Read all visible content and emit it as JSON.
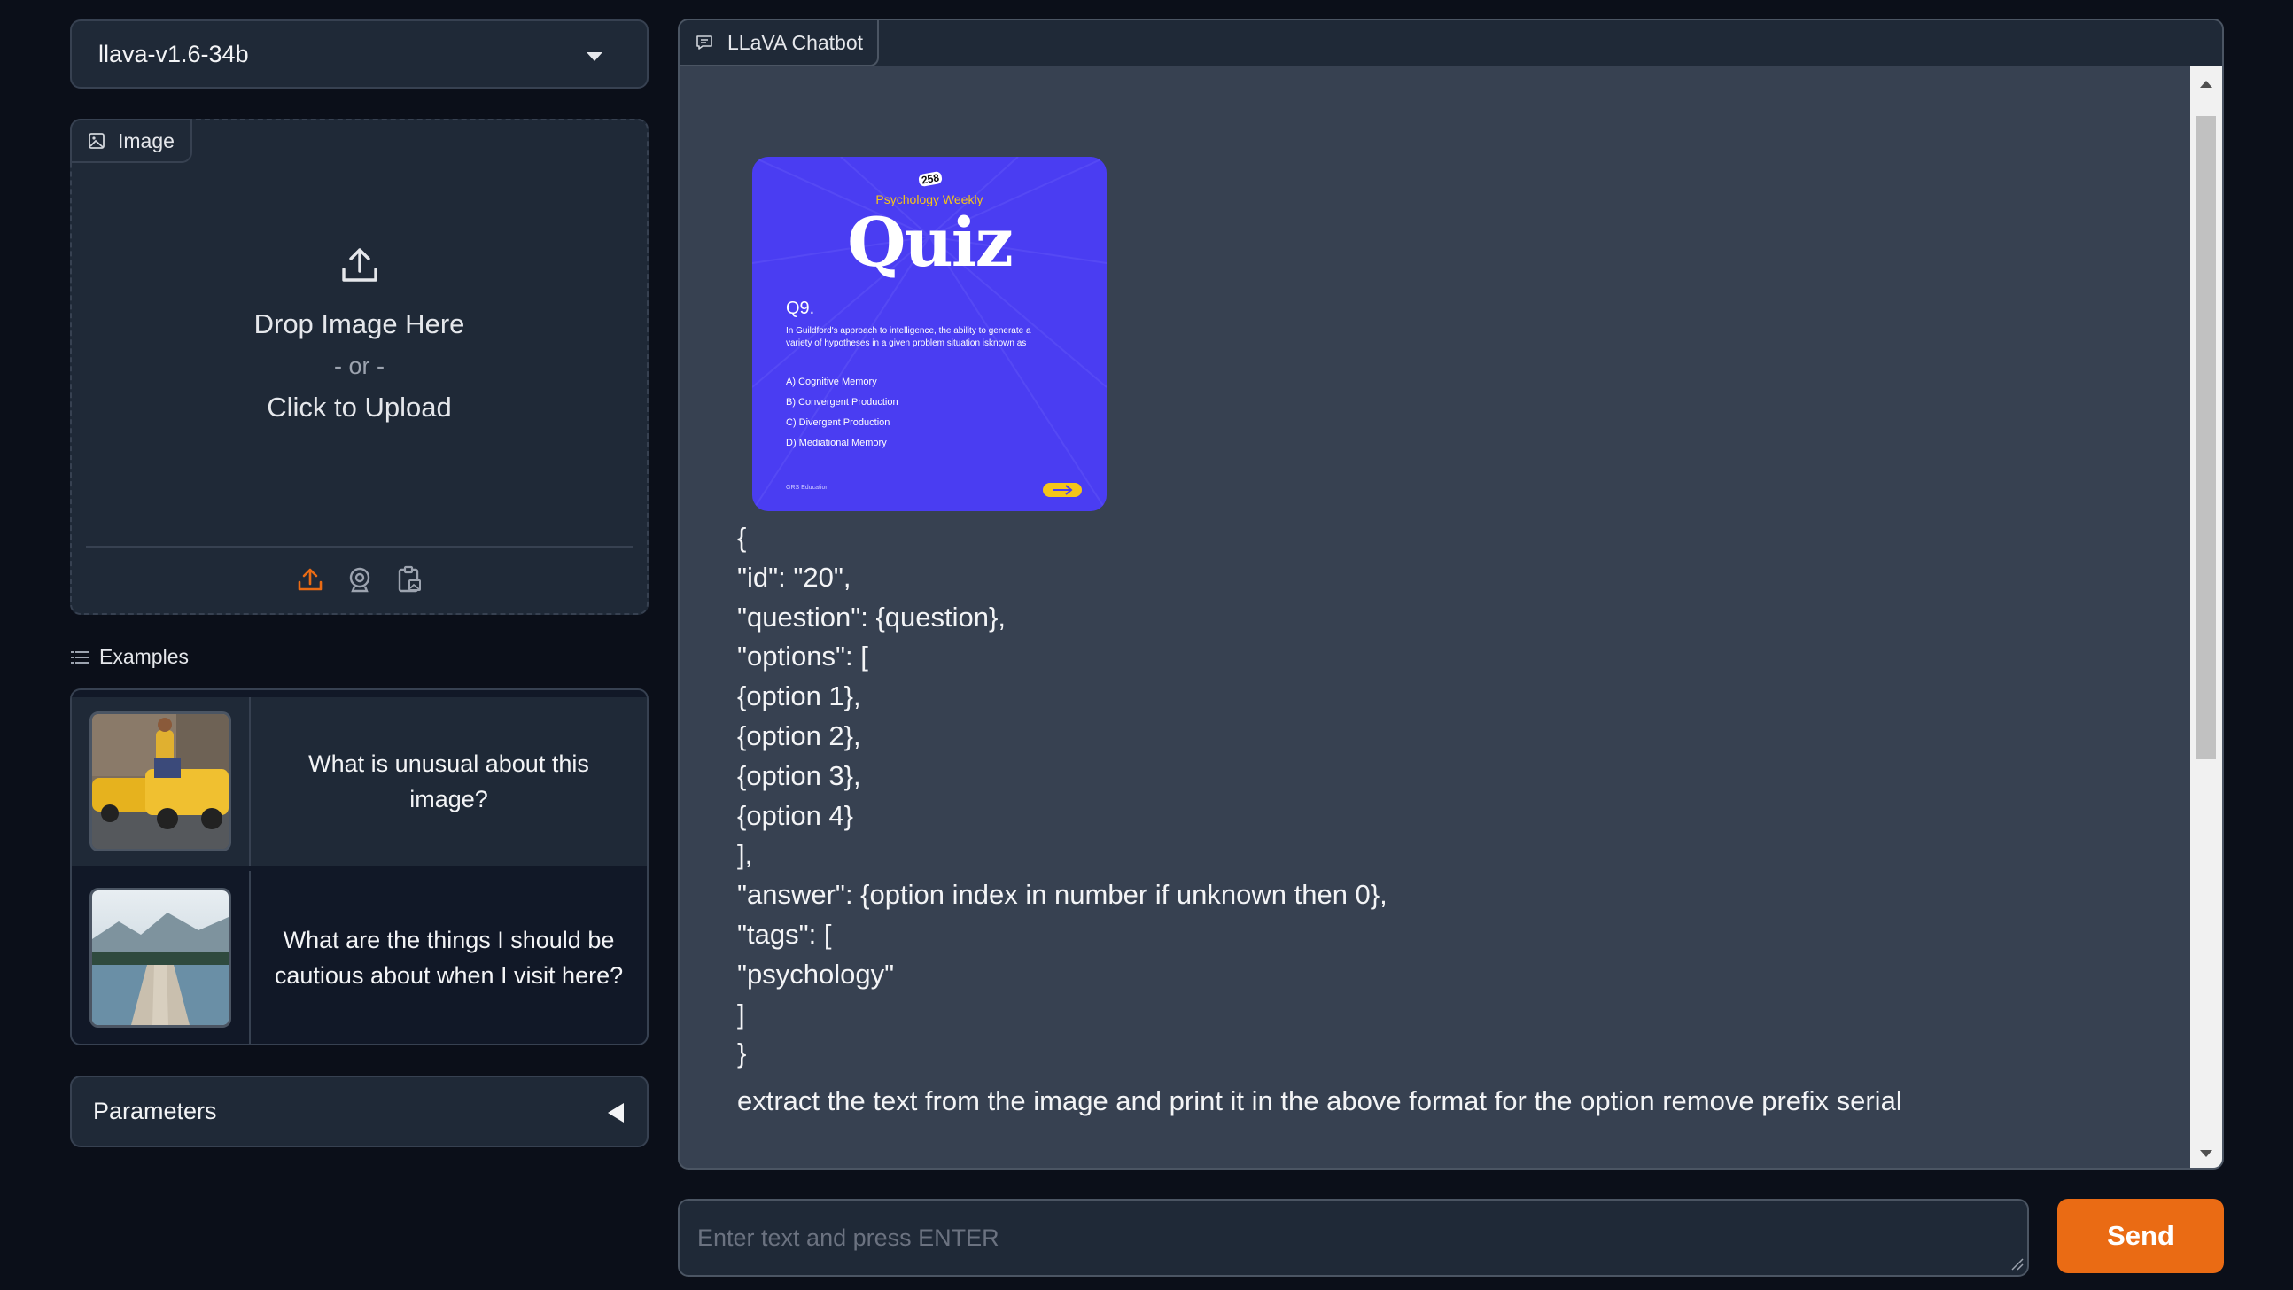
{
  "model_select": {
    "value": "llava-v1.6-34b"
  },
  "image_panel": {
    "tab_label": "Image",
    "drop_text": "Drop Image Here",
    "or_text": "- or -",
    "click_text": "Click to Upload",
    "source_icons": [
      "upload-icon",
      "webcam-icon",
      "clipboard-icon"
    ]
  },
  "examples": {
    "label": "Examples",
    "items": [
      {
        "text": "What is unusual about this image?"
      },
      {
        "text": "What are the things I should be cautious about when I visit here?"
      }
    ]
  },
  "parameters": {
    "label": "Parameters"
  },
  "chatbot": {
    "tab_label": "LLaVA Chatbot",
    "quiz_image": {
      "badge": "258",
      "subtitle": "Psychology Weekly",
      "title": "Quiz",
      "question_no": "Q9.",
      "question_text": "In Guildford's approach to intelligence, the ability to generate a variety of hypotheses in a given problem situation isknown as",
      "options": [
        "A) Cognitive Memory",
        "B) Convergent Production",
        "C) Divergent Production",
        "D) Mediational Memory"
      ],
      "footer": "GRS Education"
    },
    "json_lines": [
      "{",
      "\"id\": \"20\",",
      "\"question\": {question},",
      "\"options\": [",
      "{option 1},",
      "{option 2},",
      "{option 3},",
      "{option 4}",
      "],",
      "\"answer\": {option index in number if unknown then 0},",
      "\"tags\": [",
      "\"psychology\"",
      "]",
      "}"
    ],
    "last_message": "extract the text from the image and print it in the above format for the option remove prefix serial"
  },
  "input": {
    "placeholder": "Enter text and press ENTER",
    "value": ""
  },
  "send_button": {
    "label": "Send"
  },
  "colors": {
    "background": "#0b0f19",
    "panel": "#1f2937",
    "chat_background": "#374151",
    "accent": "#ea6b14",
    "quiz_card": "#4a3df2"
  }
}
